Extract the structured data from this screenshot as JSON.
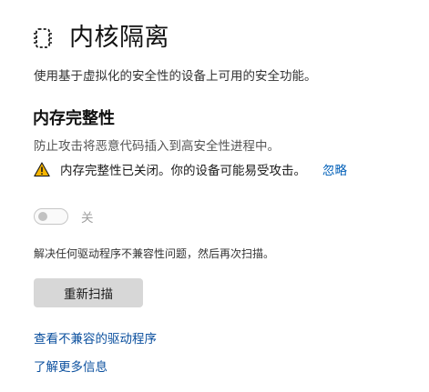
{
  "header": {
    "title": "内核隔离",
    "icon": "chip-icon"
  },
  "page_description": "使用基于虚拟化的安全性的设备上可用的安全功能。",
  "memory_integrity": {
    "title": "内存完整性",
    "description": "防止攻击将恶意代码插入到高安全性进程中。",
    "warning": {
      "icon": "warning-icon",
      "text": "内存完整性已关闭。你的设备可能易受攻击。",
      "ignore_label": "忽略",
      "icon_color": "#f7b500"
    },
    "toggle": {
      "state": "off",
      "label": "关"
    },
    "resolve_text": "解决任何驱动程序不兼容性问题，然后再次扫描。",
    "rescan_label": "重新扫描"
  },
  "links": {
    "incompatible_drivers": "查看不兼容的驱动程序",
    "learn_more": "了解更多信息"
  },
  "colors": {
    "link": "#005fb8",
    "button_bg": "#d7d7d7"
  }
}
